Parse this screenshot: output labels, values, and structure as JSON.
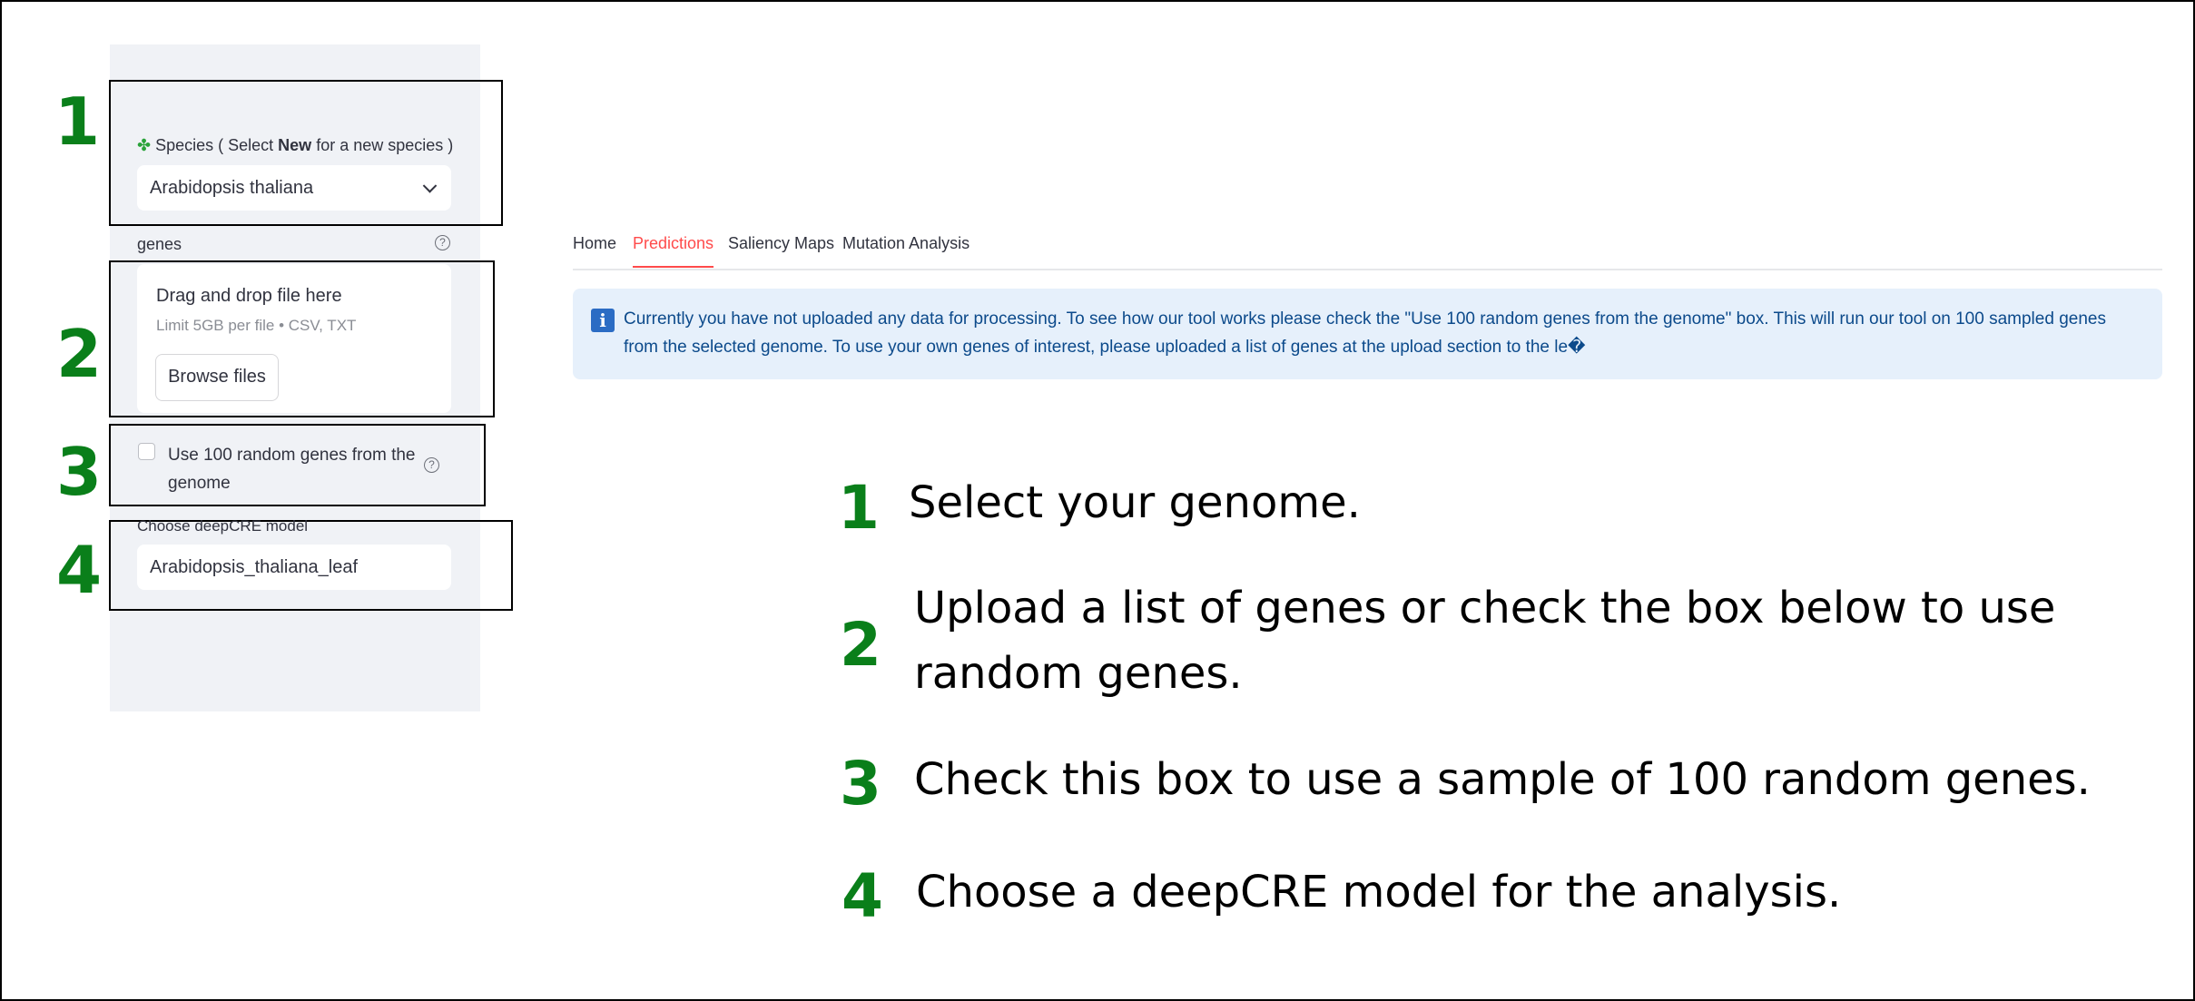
{
  "sidebar": {
    "species": {
      "icon": "clover-icon",
      "label_prefix": "Species ( Select ",
      "label_bold": "New",
      "label_suffix": " for a new species )",
      "value": "Arabidopsis thaliana"
    },
    "genes": {
      "label": "genes",
      "help": "?",
      "drop_title": "Drag and drop file here",
      "drop_limit": "Limit 5GB per file • CSV, TXT",
      "browse_label": "Browse files"
    },
    "random": {
      "label_line1": "Use 100 random genes from the",
      "label_line2": "genome",
      "help": "?",
      "checked": false
    },
    "model": {
      "label": "Choose deepCRE model",
      "value": "Arabidopsis_thaliana_leaf"
    }
  },
  "tabs": [
    {
      "label": "Home",
      "active": false
    },
    {
      "label": "Predictions",
      "active": true
    },
    {
      "label": "Saliency Maps",
      "active": false
    },
    {
      "label": "Mutation Analysis",
      "active": false
    }
  ],
  "info": {
    "icon": "i",
    "text": "Currently you have not uploaded any data for processing. To see how our tool works please check the \"Use 100 random genes from the genome\" box. This will run our tool on 100 sampled genes from the selected genome. To use your own genes of interest, please uploaded a list of genes at the upload section to the le�"
  },
  "steps": {
    "markers": [
      "1",
      "2",
      "3",
      "4"
    ],
    "instructions": [
      {
        "num": "1",
        "line1": "Select your genome.",
        "line2": ""
      },
      {
        "num": "2",
        "line1": "Upload a list of genes or check the box below to use",
        "line2": "random genes."
      },
      {
        "num": "3",
        "line1": "Check this box to use a sample of 100 random genes.",
        "line2": ""
      },
      {
        "num": "4",
        "line1": "Choose a deepCRE model for the analysis.",
        "line2": ""
      }
    ]
  },
  "colors": {
    "step_green": "#0a7f1a",
    "sidebar_bg": "#f0f2f6",
    "active_tab": "#ff4b4b",
    "info_bg": "#e6f0fb",
    "info_text": "#0c4a8b"
  }
}
